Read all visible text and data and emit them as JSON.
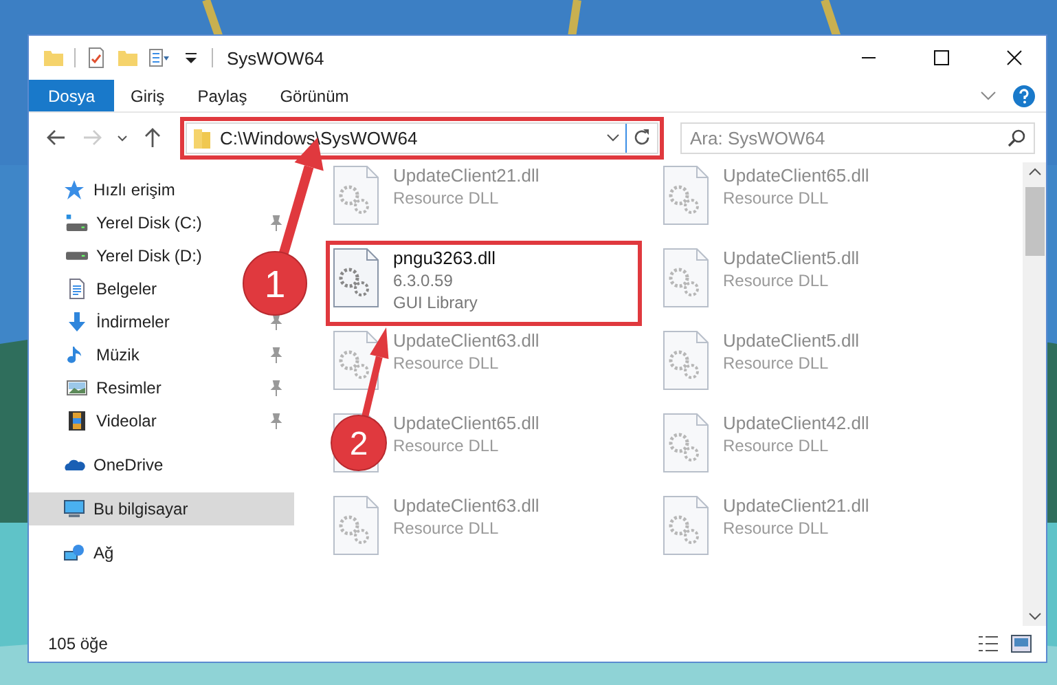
{
  "window": {
    "title": "SysWOW64"
  },
  "ribbon_tabs": [
    {
      "label": "Dosya",
      "selected": true
    },
    {
      "label": "Giriş",
      "selected": false
    },
    {
      "label": "Paylaş",
      "selected": false
    },
    {
      "label": "Görünüm",
      "selected": false
    }
  ],
  "address_bar": {
    "path": "C:\\Windows\\SysWOW64",
    "highlighted": true
  },
  "search": {
    "placeholder": "Ara: SysWOW64"
  },
  "navigation": {
    "forward_disabled": true
  },
  "sidebar": {
    "items": [
      {
        "label": "Hızlı erişim",
        "kind": "star",
        "selected": false,
        "children": [
          {
            "label": "Yerel Disk (C:)",
            "kind": "drive-c",
            "pinned": true,
            "selected": false
          },
          {
            "label": "Yerel Disk (D:)",
            "kind": "drive",
            "selected": false
          },
          {
            "label": "Belgeler",
            "kind": "document",
            "selected": false
          },
          {
            "label": "İndirmeler",
            "kind": "download",
            "pinned": true,
            "selected": false
          },
          {
            "label": "Müzik",
            "kind": "music",
            "pinned": true,
            "selected": false
          },
          {
            "label": "Resimler",
            "kind": "pictures",
            "pinned": true,
            "selected": false
          },
          {
            "label": "Videolar",
            "kind": "video",
            "pinned": true,
            "selected": false
          }
        ]
      },
      {
        "label": "OneDrive",
        "kind": "cloud",
        "selected": false
      },
      {
        "label": "Bu bilgisayar",
        "kind": "computer",
        "selected": true
      },
      {
        "label": "Ağ",
        "kind": "network",
        "selected": false
      }
    ]
  },
  "files": [
    {
      "name": "UpdateClient21.dll",
      "details": [
        "Resource DLL"
      ],
      "dimmed": true,
      "highlighted": false
    },
    {
      "name": "UpdateClient65.dll",
      "details": [
        "Resource DLL"
      ],
      "dimmed": true,
      "highlighted": false
    },
    {
      "name": "pngu3263.dll",
      "details": [
        "6.3.0.59",
        "GUI Library"
      ],
      "dimmed": false,
      "highlighted": true
    },
    {
      "name": "UpdateClient5.dll",
      "details": [
        "Resource DLL"
      ],
      "dimmed": true,
      "highlighted": false
    },
    {
      "name": "UpdateClient63.dll",
      "details": [
        "Resource DLL"
      ],
      "dimmed": true,
      "highlighted": false
    },
    {
      "name": "UpdateClient5.dll",
      "details": [
        "Resource DLL"
      ],
      "dimmed": true,
      "highlighted": false
    },
    {
      "name": "UpdateClient65.dll",
      "details": [
        "Resource DLL"
      ],
      "dimmed": true,
      "highlighted": false
    },
    {
      "name": "UpdateClient42.dll",
      "details": [
        "Resource DLL"
      ],
      "dimmed": true,
      "highlighted": false
    },
    {
      "name": "UpdateClient63.dll",
      "details": [
        "Resource DLL"
      ],
      "dimmed": true,
      "highlighted": false
    },
    {
      "name": "UpdateClient21.dll",
      "details": [
        "Resource DLL"
      ],
      "dimmed": true,
      "highlighted": false
    }
  ],
  "status_bar": {
    "item_count": "105 öğe"
  },
  "callouts": [
    {
      "number": "1"
    },
    {
      "number": "2"
    }
  ]
}
